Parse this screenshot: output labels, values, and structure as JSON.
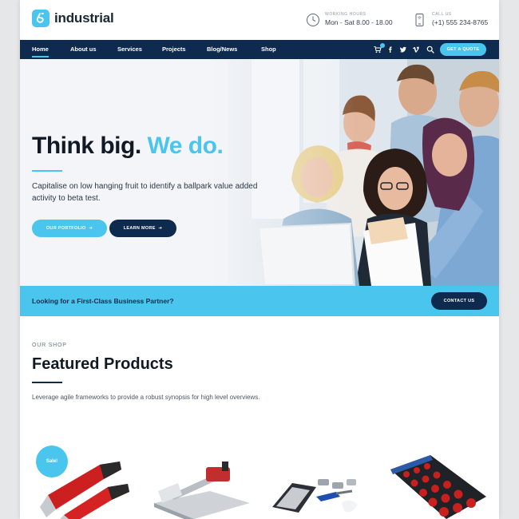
{
  "brand": {
    "name": "industrial"
  },
  "header": {
    "hours_label": "WORKING HOURS",
    "hours_value": "Mon - Sat 8.00 - 18.00",
    "call_label": "CALL US",
    "call_value": "(+1) 555 234-8765"
  },
  "nav": {
    "items": [
      "Home",
      "About us",
      "Services",
      "Projects",
      "Blog/News",
      "Shop"
    ],
    "active_index": 0,
    "quote_label": "GET A QUOTE",
    "icons": [
      "cart-icon",
      "facebook-icon",
      "twitter-icon",
      "vimeo-icon",
      "search-icon"
    ]
  },
  "hero": {
    "title_part1": "Think big.",
    "title_part2": "We do.",
    "text": "Capitalise on low hanging fruit to identify a ballpark value added activity to beta test.",
    "portfolio_label": "OUR PORTFOLIO",
    "learn_label": "LEARN MORE"
  },
  "cta": {
    "text": "Looking for a First-Class Business Partner?",
    "button_label": "CONTACT US"
  },
  "shop": {
    "eyebrow": "OUR SHOP",
    "title": "Featured Products",
    "text": "Leverage agile frameworks to provide a robust synopsis for high level overviews.",
    "sale_label": "Sale!"
  },
  "colors": {
    "accent": "#4ac6ee",
    "navy": "#0e2a4f",
    "text_dark": "#111a24"
  }
}
